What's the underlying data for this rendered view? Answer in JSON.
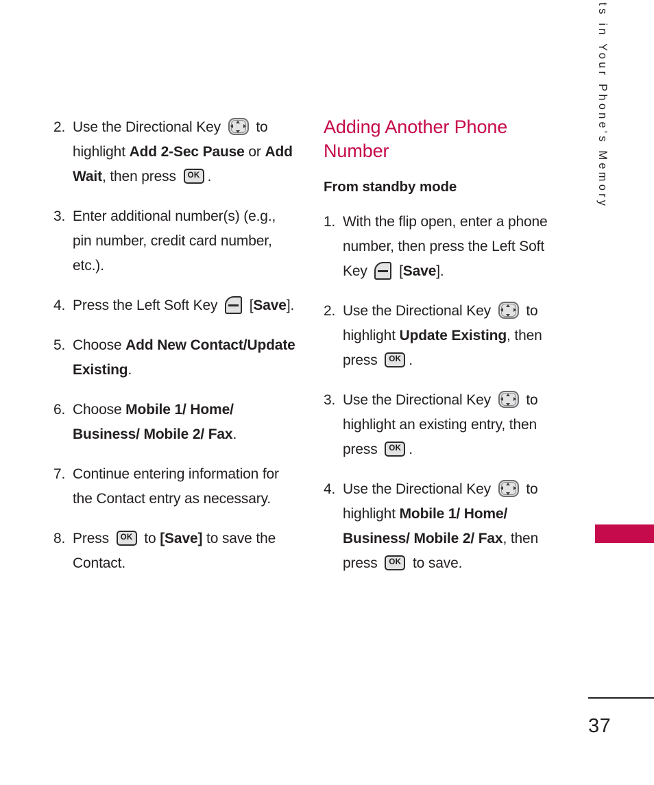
{
  "colors": {
    "heading_pink": "#C6094B",
    "tab_pink": "#C60B4C",
    "text": "#231F20"
  },
  "icons": {
    "directional_key": "directional-key-icon",
    "ok_key": "ok-key-icon",
    "ok_label": "OK",
    "left_soft_key": "left-soft-key-icon"
  },
  "left_column": {
    "steps": [
      {
        "num": "2.",
        "parts": [
          {
            "t": "Use the Directional Key "
          },
          {
            "icon": "dir"
          },
          {
            "t": " to highlight "
          },
          {
            "t": "Add 2-Sec Pause",
            "b": true
          },
          {
            "t": " or "
          },
          {
            "t": "Add Wait",
            "b": true
          },
          {
            "t": ", then press "
          },
          {
            "icon": "ok"
          },
          {
            "t": "."
          }
        ]
      },
      {
        "num": "3.",
        "parts": [
          {
            "t": "Enter additional number(s) (e.g., pin number, credit card number, etc.)."
          }
        ]
      },
      {
        "num": "4.",
        "parts": [
          {
            "t": "Press the Left Soft Key "
          },
          {
            "icon": "soft"
          },
          {
            "t": " ["
          },
          {
            "t": "Save",
            "b": true
          },
          {
            "t": "]."
          }
        ]
      },
      {
        "num": "5.",
        "parts": [
          {
            "t": "Choose "
          },
          {
            "t": "Add New Contact/Update Existing",
            "b": true
          },
          {
            "t": "."
          }
        ]
      },
      {
        "num": "6.",
        "parts": [
          {
            "t": "Choose "
          },
          {
            "t": "Mobile 1/ Home/ Business/ Mobile 2/ Fax",
            "b": true
          },
          {
            "t": "."
          }
        ]
      },
      {
        "num": "7.",
        "parts": [
          {
            "t": "Continue entering information for the Contact entry as necessary."
          }
        ]
      },
      {
        "num": "8.",
        "parts": [
          {
            "t": "Press "
          },
          {
            "icon": "ok"
          },
          {
            "t": " to "
          },
          {
            "t": "[Save]",
            "b": true
          },
          {
            "t": " to save the Contact."
          }
        ]
      }
    ]
  },
  "right_column": {
    "section_title": "Adding Another Phone Number",
    "sub_title": "From standby mode",
    "steps": [
      {
        "num": "1.",
        "parts": [
          {
            "t": "With the flip open, enter a phone number, then press the Left Soft Key "
          },
          {
            "icon": "soft"
          },
          {
            "t": " ["
          },
          {
            "t": "Save",
            "b": true
          },
          {
            "t": "]."
          }
        ]
      },
      {
        "num": "2.",
        "parts": [
          {
            "t": "Use the Directional Key "
          },
          {
            "icon": "dir"
          },
          {
            "t": " to highlight "
          },
          {
            "t": "Update Existing",
            "b": true
          },
          {
            "t": ", then press "
          },
          {
            "icon": "ok"
          },
          {
            "t": "."
          }
        ]
      },
      {
        "num": "3.",
        "parts": [
          {
            "t": "Use the Directional Key "
          },
          {
            "icon": "dir"
          },
          {
            "t": " to highlight an existing entry, then press "
          },
          {
            "icon": "ok"
          },
          {
            "t": "."
          }
        ]
      },
      {
        "num": "4.",
        "parts": [
          {
            "t": "Use the Directional Key "
          },
          {
            "icon": "dir"
          },
          {
            "t": " to highlight "
          },
          {
            "t": "Mobile 1/ Home/ Business/ Mobile 2/ Fax",
            "b": true
          },
          {
            "t": ", then press "
          },
          {
            "icon": "ok"
          },
          {
            "t": " to save."
          }
        ]
      }
    ]
  },
  "side_tab": {
    "label": "Contacts in Your Phone's Memory"
  },
  "footer": {
    "page_number": "37"
  }
}
